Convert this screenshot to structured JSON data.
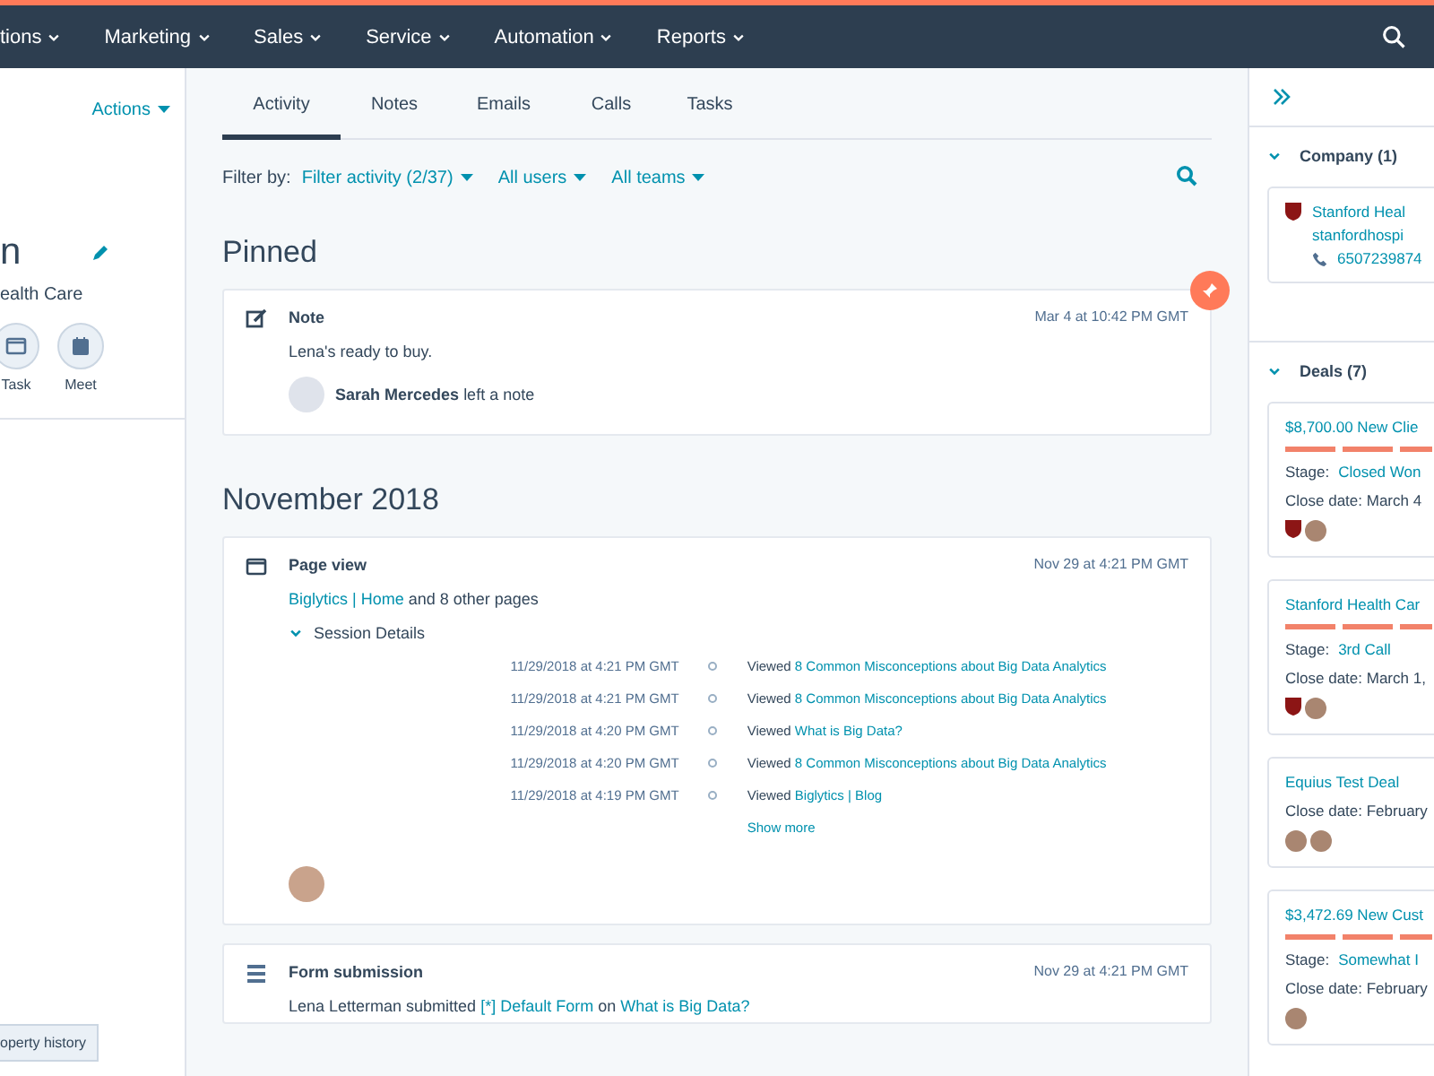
{
  "nav": {
    "items": [
      "tions",
      "Marketing",
      "Sales",
      "Service",
      "Automation",
      "Reports"
    ]
  },
  "left_panel": {
    "actions": "Actions",
    "name": "n",
    "company": "ealth Care",
    "quick_actions": [
      {
        "label": "Task",
        "kind": "task"
      },
      {
        "label": "Meet",
        "kind": "meet"
      }
    ],
    "history_button": "operty history"
  },
  "tabs": [
    {
      "label": "Activity",
      "selected": true
    },
    {
      "label": "Notes",
      "selected": false
    },
    {
      "label": "Emails",
      "selected": false
    },
    {
      "label": "Calls",
      "selected": false
    },
    {
      "label": "Tasks",
      "selected": false
    }
  ],
  "filter": {
    "label": "Filter by:",
    "options": [
      "Filter activity (2/37)",
      "All users",
      "All teams"
    ]
  },
  "pinned": {
    "heading": "Pinned",
    "note": {
      "type": "Note",
      "date": "Mar 4 at 10:42 PM GMT",
      "body": "Lena's ready to buy.",
      "author": "Sarah Mercedes",
      "action": "left a note"
    }
  },
  "month": {
    "heading": "November 2018",
    "page_view": {
      "type": "Page view",
      "date": "Nov 29 at 4:21 PM GMT",
      "link1": "Biglytics | Home",
      "rest": "and 8 other pages",
      "session": "Session Details",
      "expanded": true,
      "rows": [
        {
          "time": "11/29/2018 at 4:21 PM GMT",
          "verb": "Viewed",
          "page": "8 Common Misconceptions about Big Data Analytics"
        },
        {
          "time": "11/29/2018 at 4:21 PM GMT",
          "verb": "Viewed",
          "page": "8 Common Misconceptions about Big Data Analytics"
        },
        {
          "time": "11/29/2018 at 4:20 PM GMT",
          "verb": "Viewed",
          "page": "What is Big Data?"
        },
        {
          "time": "11/29/2018 at 4:20 PM GMT",
          "verb": "Viewed",
          "page": "8 Common Misconceptions about Big Data Analytics"
        },
        {
          "time": "11/29/2018 at 4:19 PM GMT",
          "verb": "Viewed",
          "page": "Biglytics | Blog"
        }
      ],
      "more": "Show more"
    },
    "form": {
      "type": "Form submission",
      "date": "Nov 29 at 4:21 PM GMT",
      "who": "Lena Letterman submitted",
      "form": "[*] Default Form",
      "on": "on",
      "page": "What is Big Data?"
    }
  },
  "right_panel": {
    "company": {
      "heading": "Company (1)",
      "expanded": true,
      "name": "Stanford Heal",
      "domain": "stanfordhospi",
      "phone": "6507239874"
    },
    "deals": {
      "heading": "Deals (7)",
      "expanded": true,
      "items": [
        {
          "name": "$8,700.00 New Clie",
          "level": 1,
          "stage_label": "Stage:",
          "stage": "Closed Won",
          "close": "Close date: March 4",
          "owners": [
            {
              "kind": "company"
            },
            {
              "kind": "person"
            }
          ]
        },
        {
          "name": "Stanford Health Car",
          "level": 1,
          "stage_label": "Stage:",
          "stage": "3rd Call",
          "close": "Close date: March 1,",
          "owners": [
            {
              "kind": "company"
            },
            {
              "kind": "person"
            }
          ]
        },
        {
          "name": "Equius Test Deal",
          "close": "Close date: February",
          "owners": [
            {
              "kind": "person"
            },
            {
              "kind": "person"
            }
          ]
        },
        {
          "name": "$3,472.69 New Cust",
          "level": 1,
          "stage_label": "Stage:",
          "stage": "Somewhat I",
          "close": "Close date: February",
          "owners": [
            {
              "kind": "person"
            }
          ]
        }
      ]
    }
  }
}
